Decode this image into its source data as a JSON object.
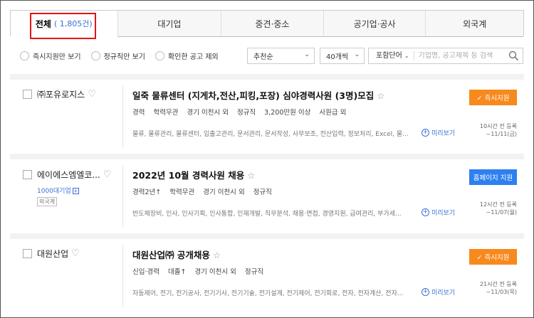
{
  "tabs": [
    {
      "label": "전체",
      "count": "( 1,805건)"
    },
    {
      "label": "대기업",
      "count": ""
    },
    {
      "label": "중견·중소",
      "count": ""
    },
    {
      "label": "공기업·공사",
      "count": ""
    },
    {
      "label": "외국계",
      "count": ""
    }
  ],
  "filters": {
    "instant_apply": "즉시지원만 보기",
    "regular_only": "정규직만 보기",
    "exclude_viewed": "확인한 공고 제외",
    "sort_selected": "추천순",
    "per_page_selected": "40개씩",
    "keyword_mode": "포함단어",
    "search_placeholder": "기업명, 공고제목 등 검색"
  },
  "jobs": [
    {
      "company": "㈜포유로지스",
      "title": "일죽 물류센터 (지게차,전산,피킹,포장) 심야경력사원 (3명)모집",
      "meta": [
        "경력",
        "학력무관",
        "경기 이천시 외",
        "정규직",
        "3,200만원 이상",
        "사원급 외"
      ],
      "keywords": "물류, 물류관리, 물류센터, 입출고관리, 문서관리, 문서작성, 사무보조, 전산입력, 정보처리, Excel, 물...",
      "preview": "미리보기",
      "button": "✓ 즉시지원",
      "posted": "10시간 전 등록",
      "deadline": "~11/11(금)"
    },
    {
      "company": "에이에스엠엘코...",
      "badge": "1000대기업",
      "tag": "외국계",
      "title": "2022년 10월 경력사원 채용",
      "meta": [
        "경력2년↑",
        "학력무관",
        "경기 이천시 외",
        "정규직"
      ],
      "keywords": "반도체장비, 인사, 인사기획, 인사통합, 인재개발, 직무분석, 채용·면접, 경영지원, 급여관리, 부가세...",
      "preview": "미리보기",
      "button": "홈페이지 지원",
      "posted": "12시간 전 등록",
      "deadline": "~11/07(월)"
    },
    {
      "company": "대원산업",
      "title": "대원산업㈜ 공개채용",
      "meta": [
        "신입·경력",
        "대졸↑",
        "경기 이천시 외",
        "정규직"
      ],
      "keywords": "자동제어, 전기, 전기공사, 전기기사, 전기기술, 전기설계, 전기제어, 전기회로, 전자, 전자계산, 전자...",
      "preview": "미리보기",
      "button": "✓ 즉시지원",
      "posted": "21시간 전 등록",
      "deadline": "~11/03(목)"
    }
  ],
  "colors": {
    "accent_blue": "#3b6fd4",
    "apply_orange": "#f7891d",
    "homepage_blue": "#2e80f0",
    "highlight_red": "#e41414"
  }
}
